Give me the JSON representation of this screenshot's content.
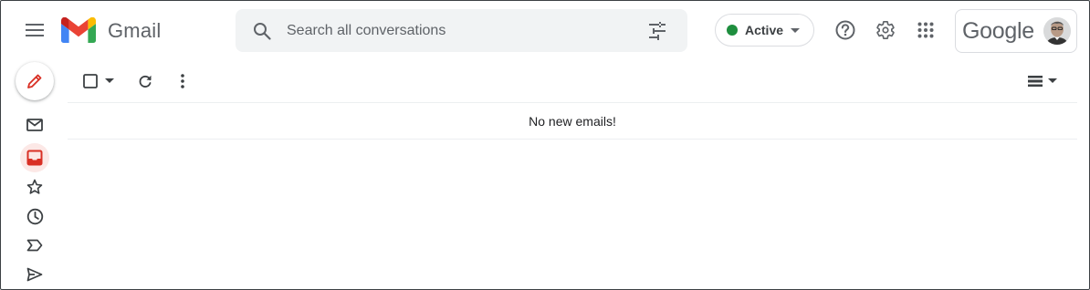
{
  "app": {
    "name": "Gmail"
  },
  "search": {
    "placeholder": "Search all conversations"
  },
  "status": {
    "label": "Active",
    "color": "#1e8e3e"
  },
  "account": {
    "brand": "Google"
  },
  "icons": {
    "menu": "hamburger-menu-icon",
    "search": "search-icon",
    "filter": "tune-icon",
    "help": "help-icon",
    "settings": "gear-icon",
    "apps": "apps-grid-icon",
    "compose": "pencil-icon",
    "select": "checkbox-icon",
    "refresh": "refresh-icon",
    "more": "more-vert-icon",
    "density": "density-icon"
  },
  "sidebar": {
    "items": [
      {
        "name": "mail",
        "icon": "mail-icon"
      },
      {
        "name": "inbox",
        "icon": "inbox-icon",
        "active": true
      },
      {
        "name": "starred",
        "icon": "star-icon"
      },
      {
        "name": "snoozed",
        "icon": "clock-icon"
      },
      {
        "name": "important",
        "icon": "label-important-icon"
      },
      {
        "name": "sent",
        "icon": "send-icon"
      }
    ]
  },
  "main": {
    "empty_message": "No new emails!"
  },
  "colors": {
    "accent": "#d93025",
    "active_bg": "#fce8e6",
    "search_bg": "#f1f3f4",
    "icon": "#5f6368"
  }
}
